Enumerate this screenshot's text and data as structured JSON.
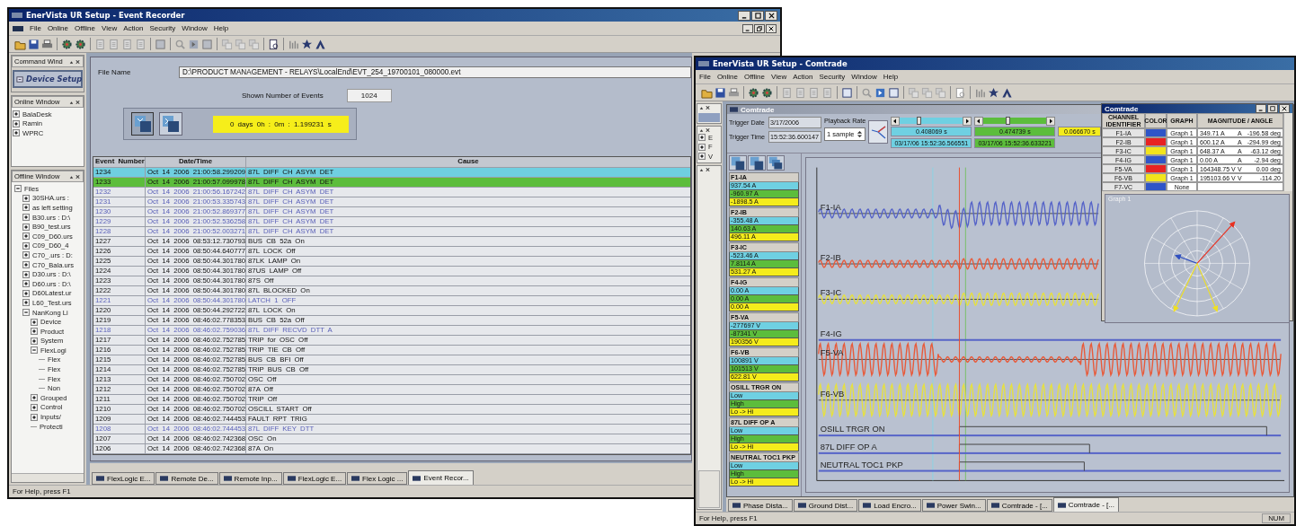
{
  "event_window": {
    "title": "EnerVista UR Setup - Event Recorder",
    "menu": [
      "File",
      "Online",
      "Offline",
      "View",
      "Action",
      "Security",
      "Window",
      "Help"
    ],
    "command_window": {
      "title": "Command Wind",
      "button": "Device Setup"
    },
    "online_window": {
      "title": "Online Window",
      "items": [
        {
          "label": "BalaDesk",
          "expanded": false
        },
        {
          "label": "Ramin",
          "expanded": false
        },
        {
          "label": "WPRC",
          "expanded": false
        }
      ]
    },
    "offline_window": {
      "title": "Offline Window",
      "tree": [
        {
          "label": "Files",
          "expanded": true,
          "children": [
            {
              "label": "30SHA.urs :",
              "expanded": false
            },
            {
              "label": "as left setting",
              "expanded": false
            },
            {
              "label": "B30.urs : D:\\",
              "expanded": false
            },
            {
              "label": "B90_test.urs",
              "expanded": false
            },
            {
              "label": "C09_D60.urs",
              "expanded": false
            },
            {
              "label": "C09_D60_4",
              "expanded": false
            },
            {
              "label": "C70_.urs : D:",
              "expanded": false
            },
            {
              "label": "C70_Bala.urs",
              "expanded": false
            },
            {
              "label": "D30.urs : D:\\",
              "expanded": false
            },
            {
              "label": "D60.urs : D:\\",
              "expanded": false
            },
            {
              "label": "D60Latest.ur",
              "expanded": false
            },
            {
              "label": "L60_Test.urs",
              "expanded": false
            },
            {
              "label": "NanKong Li",
              "expanded": true,
              "children": [
                {
                  "label": "Device",
                  "expanded": false
                },
                {
                  "label": "Product",
                  "expanded": false
                },
                {
                  "label": "System",
                  "expanded": false
                },
                {
                  "label": "FlexLogi",
                  "expanded": true,
                  "children": [
                    {
                      "label": "Flex"
                    },
                    {
                      "label": "Flex"
                    },
                    {
                      "label": "Flex"
                    },
                    {
                      "label": "Non"
                    }
                  ]
                },
                {
                  "label": "Grouped",
                  "expanded": false
                },
                {
                  "label": "Control",
                  "expanded": false
                },
                {
                  "label": "Inputs/",
                  "expanded": false
                },
                {
                  "label": "Protecti"
                }
              ]
            }
          ]
        }
      ]
    },
    "file_name": {
      "label": "File Name",
      "value": "D:\\PRODUCT MANAGEMENT - RELAYS\\LocalEnd\\EVT_254_19700101_080000.evt"
    },
    "shown_events": {
      "label": "Shown Number of Events",
      "value": "1024"
    },
    "elapsed": "0 days 0h : 0m : 1.199231 s",
    "table": {
      "columns": [
        "Event Number",
        "Date/Time",
        "Cause"
      ],
      "rows": [
        {
          "kind": "cursor_a",
          "cells": [
            "1234",
            "Oct 14 2006 21:00:58.299209",
            "87L DIFF CH ASYM DET"
          ]
        },
        {
          "kind": "cursor_b",
          "cells": [
            "1233",
            "Oct 14 2006 21:00:57.099978",
            "87L DIFF CH ASYM DET"
          ]
        },
        {
          "kind": "flagged",
          "cells": [
            "1232",
            "Oct 14 2006 21:00:56.167242",
            "87L DIFF CH ASYM DET"
          ]
        },
        {
          "kind": "flagged",
          "cells": [
            "1231",
            "Oct 14 2006 21:00:53.335743",
            "87L DIFF CH ASYM DET"
          ]
        },
        {
          "kind": "flagged",
          "cells": [
            "1230",
            "Oct 14 2006 21:00:52.869377",
            "87L DIFF CH ASYM DET"
          ]
        },
        {
          "kind": "flagged",
          "cells": [
            "1229",
            "Oct 14 2006 21:00:52.536258",
            "87L DIFF CH ASYM DET"
          ]
        },
        {
          "kind": "flagged",
          "cells": [
            "1228",
            "Oct 14 2006 21:00:52.003271",
            "87L DIFF CH ASYM DET"
          ]
        },
        {
          "kind": "plain",
          "cells": [
            "1227",
            "Oct 14 2006 08:53:12.730793",
            "BUS CB 52a On"
          ]
        },
        {
          "kind": "plain",
          "cells": [
            "1226",
            "Oct 14 2006 08:50:44.640777",
            "87L LOCK Off"
          ]
        },
        {
          "kind": "plain",
          "cells": [
            "1225",
            "Oct 14 2006 08:50:44.301780",
            "87LK LAMP On"
          ]
        },
        {
          "kind": "plain",
          "cells": [
            "1224",
            "Oct 14 2006 08:50:44.301780",
            "87US LAMP Off"
          ]
        },
        {
          "kind": "plain",
          "cells": [
            "1223",
            "Oct 14 2006 08:50:44.301780",
            "87S Off"
          ]
        },
        {
          "kind": "plain",
          "cells": [
            "1222",
            "Oct 14 2006 08:50:44.301780",
            "87L BLOCKED On"
          ]
        },
        {
          "kind": "flagged",
          "cells": [
            "1221",
            "Oct 14 2006 08:50:44.301780",
            "LATCH 1 OFF"
          ]
        },
        {
          "kind": "plain",
          "cells": [
            "1220",
            "Oct 14 2006 08:50:44.292722",
            "87L LOCK On"
          ]
        },
        {
          "kind": "plain",
          "cells": [
            "1219",
            "Oct 14 2006 08:46:02.778353",
            "BUS CB 52a Off"
          ]
        },
        {
          "kind": "flagged",
          "cells": [
            "1218",
            "Oct 14 2006 08:46:02.759036",
            "87L DIFF RECVD DTT A"
          ]
        },
        {
          "kind": "plain",
          "cells": [
            "1217",
            "Oct 14 2006 08:46:02.752785",
            "TRIP for OSC Off"
          ]
        },
        {
          "kind": "plain",
          "cells": [
            "1216",
            "Oct 14 2006 08:46:02.752785",
            "TRIP TIE CB Off"
          ]
        },
        {
          "kind": "plain",
          "cells": [
            "1215",
            "Oct 14 2006 08:46:02.752785",
            "BUS CB BFI Off"
          ]
        },
        {
          "kind": "plain",
          "cells": [
            "1214",
            "Oct 14 2006 08:46:02.752785",
            "TRIP BUS CB Off"
          ]
        },
        {
          "kind": "plain",
          "cells": [
            "1213",
            "Oct 14 2006 08:46:02.750702",
            "OSC Off"
          ]
        },
        {
          "kind": "plain",
          "cells": [
            "1212",
            "Oct 14 2006 08:46:02.750702",
            "87A Off"
          ]
        },
        {
          "kind": "plain",
          "cells": [
            "1211",
            "Oct 14 2006 08:46:02.750702",
            "TRIP Off"
          ]
        },
        {
          "kind": "plain",
          "cells": [
            "1210",
            "Oct 14 2006 08:46:02.750702",
            "OSCILL START Off"
          ]
        },
        {
          "kind": "plain",
          "cells": [
            "1209",
            "Oct 14 2006 08:46:02.744453",
            "FAULT RPT TRIG"
          ]
        },
        {
          "kind": "flagged",
          "cells": [
            "1208",
            "Oct 14 2006 08:46:02.744453",
            "87L DIFF KEY DTT"
          ]
        },
        {
          "kind": "plain",
          "cells": [
            "1207",
            "Oct 14 2006 08:46:02.742368",
            "OSC On"
          ]
        },
        {
          "kind": "plain",
          "cells": [
            "1206",
            "Oct 14 2006 08:46:02.742368",
            "87A On"
          ]
        }
      ]
    },
    "tabs": [
      {
        "label": "FlexLogic E...",
        "selected": false
      },
      {
        "label": "Remote De...",
        "selected": false
      },
      {
        "label": "Remote Inp...",
        "selected": false
      },
      {
        "label": "FlexLogic E...",
        "selected": false
      },
      {
        "label": "Flex Logic ...",
        "selected": false
      },
      {
        "label": "Event Recor...",
        "selected": true
      }
    ],
    "status_bar": "For Help, press F1"
  },
  "comtrade_window": {
    "title": "EnerVista UR Setup - Comtrade",
    "menu": [
      "File",
      "Online",
      "Offline",
      "View",
      "Action",
      "Security",
      "Window",
      "Help"
    ],
    "side_tree": [
      {
        "label": "E",
        "expanded": false
      },
      {
        "label": "F",
        "expanded": false
      },
      {
        "label": "V",
        "expanded": false
      }
    ],
    "inner_title": "Comtrade",
    "trigger_date": {
      "label": "Trigger Date",
      "value": "3/17/2006"
    },
    "trigger_time": {
      "label": "Trigger Time",
      "value": "15:52:36.600147"
    },
    "playback_rate": {
      "label": "Playback Rate",
      "value": "1 sample"
    },
    "cursors": [
      {
        "color": "#6fd0e2",
        "level": 0.3,
        "delta": "0.408069 s",
        "timestamp": "03/17/06 15:52:36.566551"
      },
      {
        "color": "#5cbd3c",
        "level": 0.38,
        "delta": "0.474739 s",
        "timestamp": "03/17/06 15:52:36.633221"
      }
    ],
    "cursor_difference": "0.066670 s",
    "channels": [
      {
        "name": "F1-IA",
        "values": [
          "937.54 A",
          "-960.97 A",
          "-1898.5 A"
        ]
      },
      {
        "name": "F2-IB",
        "values": [
          "-355.48 A",
          "140.63 A",
          "496.11 A"
        ]
      },
      {
        "name": "F3-IC",
        "values": [
          "-523.46 A",
          "7.8114 A",
          "531.27 A"
        ]
      },
      {
        "name": "F4-IG",
        "values": [
          "0.00 A",
          "0.00 A",
          "0.00 A"
        ]
      },
      {
        "name": "F5-VA",
        "values": [
          "-277697 V",
          "-87341 V",
          "190356 V"
        ]
      },
      {
        "name": "F6-VB",
        "values": [
          "100891 V",
          "101513 V",
          "622.81 V"
        ]
      },
      {
        "name": "OSILL TRGR ON",
        "values": [
          "Low",
          "High",
          "Lo -> Hi"
        ]
      },
      {
        "name": "87L DIFF OP A",
        "values": [
          "Low",
          "High",
          "Lo -> Hi"
        ]
      },
      {
        "name": "NEUTRAL TOC1 PKP",
        "values": [
          "Low",
          "High",
          "Lo -> Hi"
        ]
      }
    ],
    "traces": [
      {
        "label": "F1-IA",
        "kind": "wave",
        "color": "#5563c8"
      },
      {
        "label": "F2-IB",
        "kind": "wave",
        "color": "#e85a3a"
      },
      {
        "label": "F3-IC",
        "kind": "wave",
        "color": "#e6e040"
      },
      {
        "label": "F4-IG",
        "kind": "flat",
        "color": "#5563c8"
      },
      {
        "label": "F5-VA",
        "kind": "wave",
        "color": "#e85a3a"
      },
      {
        "label": "F6-VB",
        "kind": "wave",
        "color": "#e6e040"
      },
      {
        "label": "OSILL TRGR ON",
        "kind": "digital",
        "color": "#5563c8"
      },
      {
        "label": "87L DIFF OP A",
        "kind": "digital",
        "color": "#5563c8"
      },
      {
        "label": "NEUTRAL TOC1 PKP",
        "kind": "digital",
        "color": "#5563c8"
      }
    ],
    "phasor_window": {
      "title": "Comtrade",
      "columns": [
        "CHANNEL IDENTIFIER",
        "COLOR",
        "GRAPH",
        "MAGNITUDE / ANGLE"
      ],
      "rows": [
        {
          "channel": "F1-IA",
          "color": "#2f55c8",
          "graph": "Graph 1",
          "magnitude": "349.71 A",
          "unit": "A",
          "angle": "-196.58 deg"
        },
        {
          "channel": "F2-IB",
          "color": "#e82222",
          "graph": "Graph 1",
          "magnitude": "600.12 A",
          "unit": "A",
          "angle": "-294.99 deg"
        },
        {
          "channel": "F3-IC",
          "color": "#f2e41c",
          "graph": "Graph 1",
          "magnitude": "648.37 A",
          "unit": "A",
          "angle": "-63.12 deg"
        },
        {
          "channel": "F4-IG",
          "color": "#2f55c8",
          "graph": "Graph 1",
          "magnitude": "0.00 A",
          "unit": "A",
          "angle": "-2.94 deg"
        },
        {
          "channel": "F5-VA",
          "color": "#e82222",
          "graph": "Graph 1",
          "magnitude": "164348.75 V",
          "unit": "V",
          "angle": "0.00 deg"
        },
        {
          "channel": "F6-VB",
          "color": "#f2e41c",
          "graph": "Graph 1",
          "magnitude": "195103.66 V",
          "unit": "V",
          "angle": "-114.20"
        },
        {
          "channel": "F7-VC",
          "color": "#2f55c8",
          "graph": "None"
        }
      ],
      "graph_title": "Graph 1"
    },
    "tabs": [
      {
        "label": "Phase Dista...",
        "selected": false
      },
      {
        "label": "Ground Dist...",
        "selected": false
      },
      {
        "label": "Load Encro...",
        "selected": false
      },
      {
        "label": "Power Swin...",
        "selected": false
      },
      {
        "label": "Comtrade - [...",
        "selected": false
      },
      {
        "label": "Comtrade - [...",
        "selected": true
      }
    ],
    "status_bar": "For Help, press F1",
    "indicator": "NUM"
  }
}
